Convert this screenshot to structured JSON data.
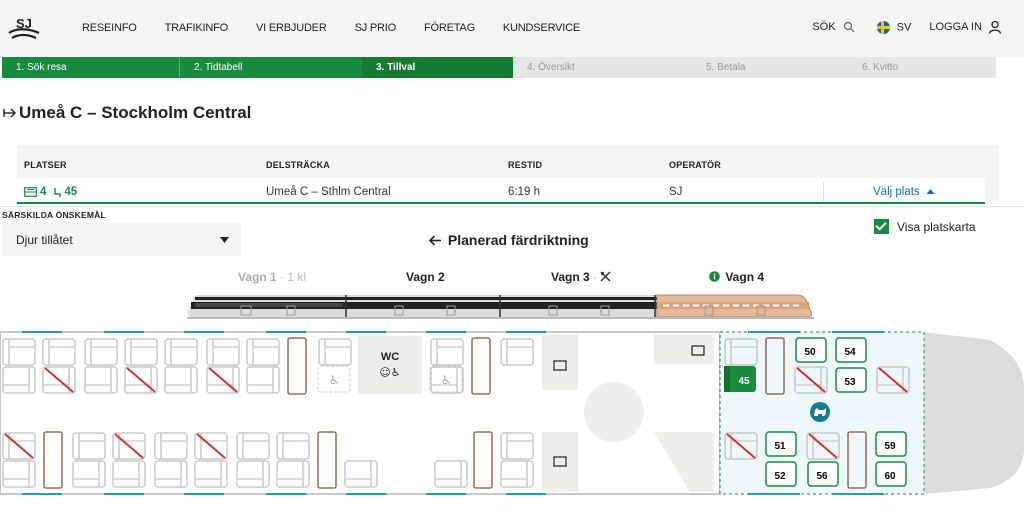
{
  "nav": {
    "links": [
      "RESEINFO",
      "TRAFIKINFO",
      "VI ERBJUDER",
      "SJ PRIO",
      "FÖRETAG",
      "KUNDSERVICE"
    ],
    "search": "SÖK",
    "lang": "SV",
    "login": "LOGGA IN"
  },
  "steps": [
    {
      "label": "1. Sök resa",
      "state": "done"
    },
    {
      "label": "2. Tidtabell",
      "state": "done"
    },
    {
      "label": "3. Tillval",
      "state": "active"
    },
    {
      "label": "4. Översikt",
      "state": "todo"
    },
    {
      "label": "5. Betala",
      "state": "todo"
    },
    {
      "label": "6. Kvitto",
      "state": "todo"
    }
  ],
  "trip": {
    "title": "Umeå C – Stockholm Central"
  },
  "table": {
    "headers": {
      "seats": "PLATSER",
      "segment": "DELSTRÄCKA",
      "duration": "RESTID",
      "operator": "OPERATÖR"
    },
    "row": {
      "car": "4",
      "seat": "45",
      "segment": "Umeå C – Sthlm Central",
      "duration": "6:19 h",
      "operator": "SJ",
      "choose": "Välj plats"
    }
  },
  "special": {
    "label": "SÄRSKILDA ÖNSKEMÅL",
    "value": "Djur tillåtet"
  },
  "direction": "Planerad färdriktning",
  "show_map": "Visa platskarta",
  "cars": [
    {
      "name": "Vagn 1",
      "cls": "1 kl",
      "state": "disabled"
    },
    {
      "name": "Vagn 2",
      "state": "normal"
    },
    {
      "name": "Vagn 3",
      "state": "normal",
      "icon": "restaurant-icon"
    },
    {
      "name": "Vagn 4",
      "state": "selected",
      "icon": "info-icon"
    }
  ],
  "seatmap": {
    "wc_label": "WC",
    "selected_seat": "45",
    "available_seats": [
      "50",
      "54",
      "53",
      "51",
      "52",
      "56",
      "59",
      "60"
    ]
  },
  "colors": {
    "green": "#1a8b3c",
    "teal": "#1a7a8a",
    "gray": "#bbbbbb",
    "wood": "#9a6a50",
    "red": "#d0342c"
  }
}
